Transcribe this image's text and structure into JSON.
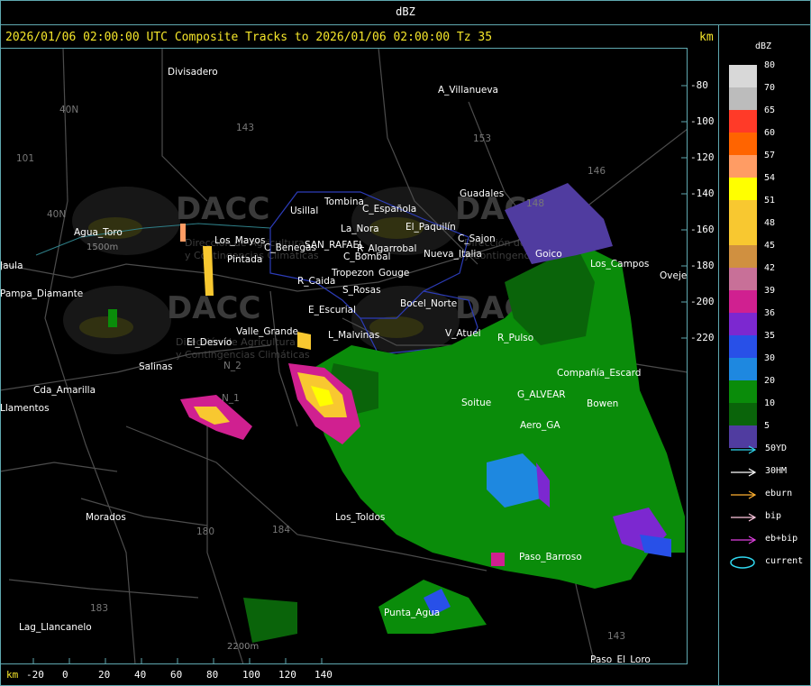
{
  "window": {
    "title": "dBZ"
  },
  "header": {
    "text": "2026/01/06 02:00:00 UTC Composite Tracks to 2026/01/06 02:00:00 Tz 35",
    "unit": "km"
  },
  "axes": {
    "x_unit": "km",
    "x_ticks": [
      "-20",
      "0",
      "20",
      "40",
      "60",
      "80",
      "100",
      "120",
      "140"
    ],
    "y_ticks": [
      "-80",
      "-100",
      "-120",
      "-140",
      "-160",
      "-180",
      "-200",
      "-220"
    ]
  },
  "watermark": {
    "logo": "DACC",
    "line1": "Dirección de Agricultura",
    "line2": "y Contingencias Climáticas"
  },
  "places": [
    "Divisadero",
    "A_Villanueva",
    "Guadales",
    "Tombina",
    "Usillal",
    "C_Española",
    "La_Nora",
    "El_Paquilín",
    "Agua_Toro",
    "Los_Mayos",
    "C_Benegas",
    "SAN_RAFAEL",
    "R_Algarrobal",
    "Goico",
    "Los_Campos",
    "Oveje",
    "Pampa_Diamante",
    "Pintada",
    "R_Caida",
    "S_Rosas",
    "Bocel_Norte",
    "E_Escurial",
    "Valle_Grande",
    "L_Malvinas",
    "V_Atuel",
    "R_Pulso",
    "El_Desvío",
    "Salinas",
    "Cda_Amarilla",
    "Soitue",
    "Compañía_Escard",
    "G_ALVEAR",
    "Bowen",
    "Aero_GA",
    "Los_Toldos",
    "Morados",
    "Paso_Barroso",
    "Punta_Agua",
    "Lag_Llancanelo",
    "Paso_El_Loro",
    "Jaula",
    "Llamentos",
    "Tropezon",
    "Gouge",
    "C_Bombal",
    "Nueva_Italia",
    "C_Sajon"
  ],
  "route_labels": [
    "40N",
    "101",
    "143",
    "153",
    "146",
    "40N",
    "184",
    "180",
    "183",
    "143",
    "148",
    "N_2",
    "N_1"
  ],
  "elevations": [
    "1500m",
    "2200m"
  ],
  "legend": {
    "title": "dBZ",
    "items": [
      {
        "label": "80",
        "color": "#d8d8d8"
      },
      {
        "label": "70",
        "color": "#bcbcbc"
      },
      {
        "label": "65",
        "color": "#ff3a28"
      },
      {
        "label": "60",
        "color": "#ff6400"
      },
      {
        "label": "57",
        "color": "#ff9c64"
      },
      {
        "label": "54",
        "color": "#ffff00"
      },
      {
        "label": "51",
        "color": "#f8c830"
      },
      {
        "label": "48",
        "color": "#f8c830"
      },
      {
        "label": "45",
        "color": "#d09040"
      },
      {
        "label": "42",
        "color": "#c87098"
      },
      {
        "label": "39",
        "color": "#d02090"
      },
      {
        "label": "36",
        "color": "#7c28d0"
      },
      {
        "label": "35",
        "color": "#2850e8"
      },
      {
        "label": "30",
        "color": "#1e88e0"
      },
      {
        "label": "20",
        "color": "#0a8c0a"
      },
      {
        "label": "10",
        "color": "#0a640a"
      },
      {
        "label": "5",
        "color": "#503ca0"
      }
    ]
  },
  "tracks": [
    {
      "label": "50YD",
      "color": "#30d8f0"
    },
    {
      "label": "30HM",
      "color": "#ffffff"
    },
    {
      "label": "eburn",
      "color": "#ffb030"
    },
    {
      "label": "bip",
      "color": "#ffc8e0"
    },
    {
      "label": "eb+bip",
      "color": "#e040e0"
    },
    {
      "label": "current",
      "color": "#30d8f0"
    }
  ]
}
